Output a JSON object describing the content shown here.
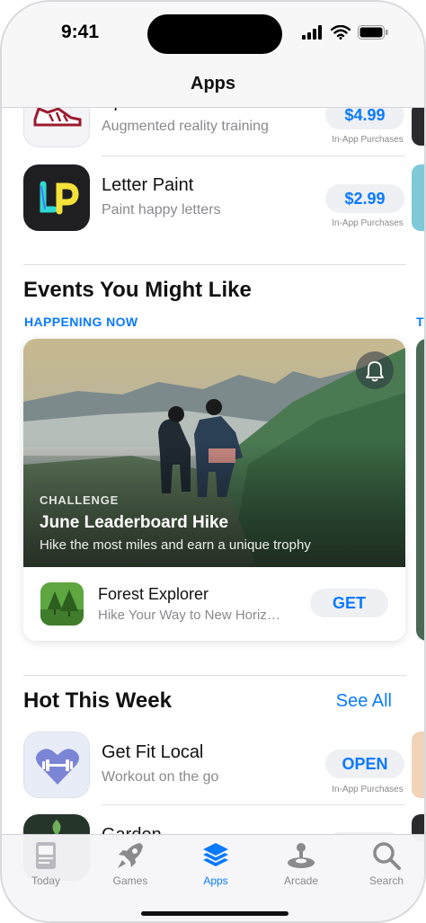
{
  "status_bar": {
    "time": "9:41"
  },
  "nav": {
    "title": "Apps"
  },
  "top_apps": [
    {
      "name": "Sprint Trainer",
      "subtitle": "Augmented reality training",
      "price": "$4.99",
      "note": "In-App Purchases"
    },
    {
      "name": "Letter Paint",
      "subtitle": "Paint happy letters",
      "price": "$2.99",
      "note": "In-App Purchases"
    }
  ],
  "events_section": {
    "title": "Events You Might Like",
    "eyebrow": "HAPPENING NOW",
    "eyebrow_peek": "TO",
    "card": {
      "category": "CHALLENGE",
      "title": "June Leaderboard Hike",
      "subtitle": "Hike the most miles and earn a unique trophy",
      "app_name": "Forest Explorer",
      "app_subtitle": "Hike Your Way to New Horiz…",
      "button": "GET",
      "bell_icon": "bell-icon"
    }
  },
  "hot_section": {
    "title": "Hot This Week",
    "link": "See All",
    "apps": [
      {
        "name": "Get Fit Local",
        "subtitle": "Workout on the go",
        "button": "OPEN",
        "note": "In-App Purchases"
      },
      {
        "name": "Garden",
        "subtitle": "",
        "button": "",
        "note": ""
      }
    ]
  },
  "tab_bar": {
    "active": "Apps",
    "tabs": [
      {
        "label": "Today",
        "icon": "today-icon"
      },
      {
        "label": "Games",
        "icon": "rocket-icon"
      },
      {
        "label": "Apps",
        "icon": "layers-icon"
      },
      {
        "label": "Arcade",
        "icon": "joystick-icon"
      },
      {
        "label": "Search",
        "icon": "search-icon"
      }
    ]
  },
  "colors": {
    "accent": "#0a7aff",
    "secondary_text": "#8a8a8e"
  }
}
